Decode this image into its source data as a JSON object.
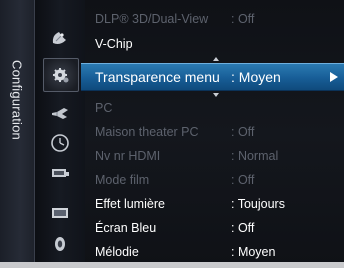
{
  "side_tab": {
    "label": "Configuration"
  },
  "menu": {
    "rows": [
      {
        "label": "DLP® 3D/Dual-View",
        "value": ": Off",
        "state": "disabled"
      },
      {
        "label": "V-Chip",
        "value": "",
        "state": "enabled"
      },
      {
        "label": "Transparence menu",
        "value": ": Moyen",
        "state": "selected"
      },
      {
        "label": "PC",
        "value": "",
        "state": "disabled"
      },
      {
        "label": "Maison theater PC",
        "value": ": Off",
        "state": "disabled"
      },
      {
        "label": "Nv nr HDMI",
        "value": ": Normal",
        "state": "disabled"
      },
      {
        "label": "Mode film",
        "value": ": Off",
        "state": "disabled"
      },
      {
        "label": "Effet lumière",
        "value": ": Toujours",
        "state": "enabled"
      },
      {
        "label": "Écran Bleu",
        "value": ": Off",
        "state": "enabled"
      },
      {
        "label": "Mélodie",
        "value": ": Moyen",
        "state": "enabled"
      }
    ]
  },
  "icons": [
    "satellite-dish-icon",
    "gear-setup-icon",
    "speaker-icon",
    "clock-icon",
    "input-source-icon",
    "picture-icon",
    "sound-icon"
  ],
  "colors": {
    "selected_bar": "#175d96",
    "text_enabled": "#ffffff",
    "text_disabled": "#5d626d"
  }
}
